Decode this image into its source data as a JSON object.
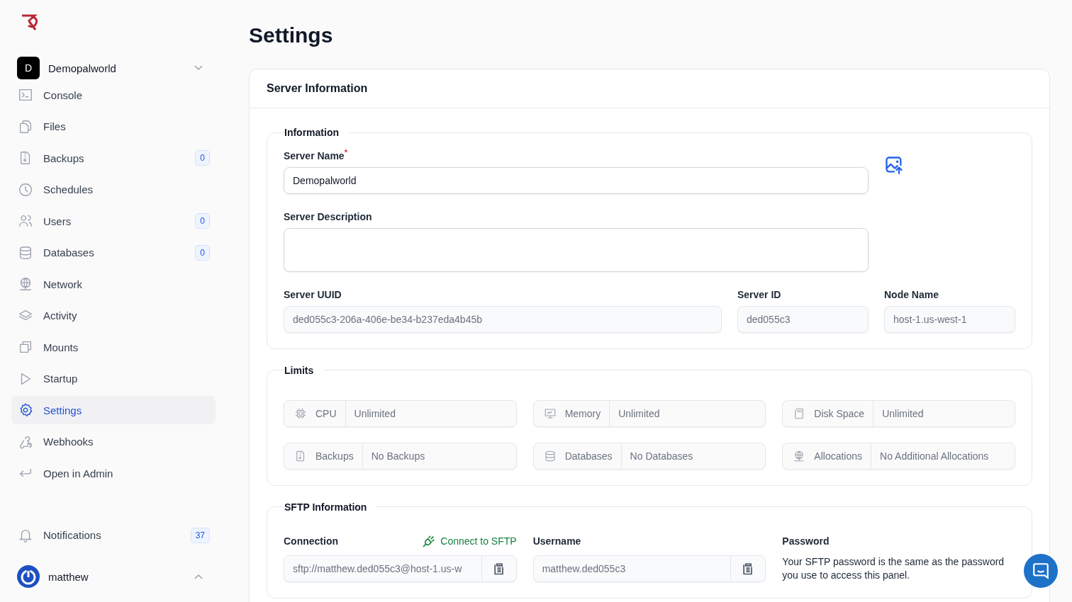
{
  "sidebar": {
    "server": {
      "initial": "D",
      "name": "Demopalworld"
    },
    "items": [
      {
        "label": "Console",
        "kind": "console",
        "selected": false
      },
      {
        "label": "Files",
        "kind": "files",
        "selected": false
      },
      {
        "label": "Backups",
        "kind": "zip",
        "badge": "0",
        "selected": false
      },
      {
        "label": "Schedules",
        "kind": "clock",
        "selected": false
      },
      {
        "label": "Users",
        "kind": "users",
        "badge": "0",
        "selected": false
      },
      {
        "label": "Databases",
        "kind": "database",
        "badge": "0",
        "selected": false
      },
      {
        "label": "Network",
        "kind": "globe",
        "selected": false
      },
      {
        "label": "Activity",
        "kind": "stack",
        "selected": false
      },
      {
        "label": "Mounts",
        "kind": "mounts",
        "selected": false
      },
      {
        "label": "Startup",
        "kind": "play",
        "selected": false
      },
      {
        "label": "Settings",
        "kind": "gear",
        "selected": true
      },
      {
        "label": "Webhooks",
        "kind": "webhook",
        "selected": false
      },
      {
        "label": "Open in Admin",
        "kind": "return",
        "selected": false
      }
    ],
    "notifications": {
      "label": "Notifications",
      "badge": "37"
    },
    "user": {
      "name": "matthew"
    }
  },
  "page_title": "Settings",
  "card_title": "Server Information",
  "information": {
    "legend": "Information",
    "server_name": {
      "label": "Server Name",
      "required": "*",
      "value": "Demopalworld"
    },
    "server_description": {
      "label": "Server Description"
    },
    "server_uuid": {
      "label": "Server UUID",
      "value": "ded055c3-206a-406e-be34-b237eda4b45b"
    },
    "server_id": {
      "label": "Server ID",
      "value": "ded055c3"
    },
    "node_name": {
      "label": "Node Name",
      "value": "host-1.us-west-1"
    }
  },
  "limits": {
    "legend": "Limits",
    "items": [
      {
        "kind": "cpu",
        "label": "CPU",
        "value": "Unlimited"
      },
      {
        "kind": "monitor",
        "label": "Memory",
        "value": "Unlimited"
      },
      {
        "kind": "sdcard",
        "label": "Disk Space",
        "value": "Unlimited"
      },
      {
        "kind": "zip",
        "label": "Backups",
        "value": "No Backups"
      },
      {
        "kind": "database",
        "label": "Databases",
        "value": "No Databases"
      },
      {
        "kind": "globe",
        "label": "Allocations",
        "value": "No Additional Allocations"
      }
    ]
  },
  "sftp": {
    "legend": "SFTP Information",
    "connection": {
      "label": "Connection",
      "link": "Connect to SFTP",
      "value": "sftp://matthew.ded055c3@host-1.us-w"
    },
    "username": {
      "label": "Username",
      "value": "matthew.ded055c3"
    },
    "password": {
      "label": "Password",
      "text": "Your SFTP password is the same as the password you use to access this panel."
    }
  }
}
